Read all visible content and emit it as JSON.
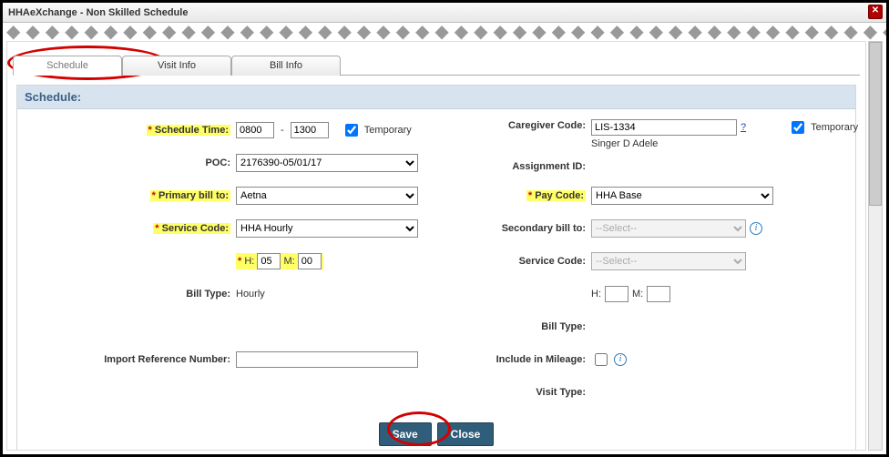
{
  "window": {
    "title": "HHAeXchange - Non Skilled Schedule"
  },
  "tabs": {
    "schedule": "Schedule",
    "visit_info": "Visit Info",
    "bill_info": "Bill Info"
  },
  "section": {
    "title": "Schedule:"
  },
  "left": {
    "schedule_time_label": "Schedule Time:",
    "schedule_time_from": "0800",
    "schedule_time_to": "1300",
    "temporary_label": "Temporary",
    "poc_label": "POC:",
    "poc_value": "2176390-05/01/17",
    "primary_bill_label": "Primary bill to:",
    "primary_bill_value": "Aetna",
    "service_code_label": "Service Code:",
    "service_code_value": "HHA Hourly",
    "h_label": "H:",
    "m_label": "M:",
    "h_value": "05",
    "m_value": "00",
    "bill_type_label": "Bill Type:",
    "bill_type_value": "Hourly",
    "import_ref_label": "Import Reference Number:",
    "import_ref_value": ""
  },
  "right": {
    "caregiver_code_label": "Caregiver Code:",
    "caregiver_code_value": "LIS-1334",
    "caregiver_help": "?",
    "caregiver_name": "Singer D Adele",
    "temp2_label": "Temporary",
    "assignment_id_label": "Assignment ID:",
    "pay_code_label": "Pay Code:",
    "pay_code_value": "HHA Base",
    "secondary_bill_label": "Secondary bill to:",
    "secondary_bill_value": "--Select--",
    "service_code2_label": "Service Code:",
    "service_code2_value": "--Select--",
    "h2_label": "H:",
    "m2_label": "M:",
    "h2_value": "",
    "m2_value": "",
    "bill_type2_label": "Bill Type:",
    "include_mileage_label": "Include in Mileage:",
    "visit_type_label": "Visit Type:"
  },
  "buttons": {
    "save": "Save",
    "close": "Close"
  }
}
